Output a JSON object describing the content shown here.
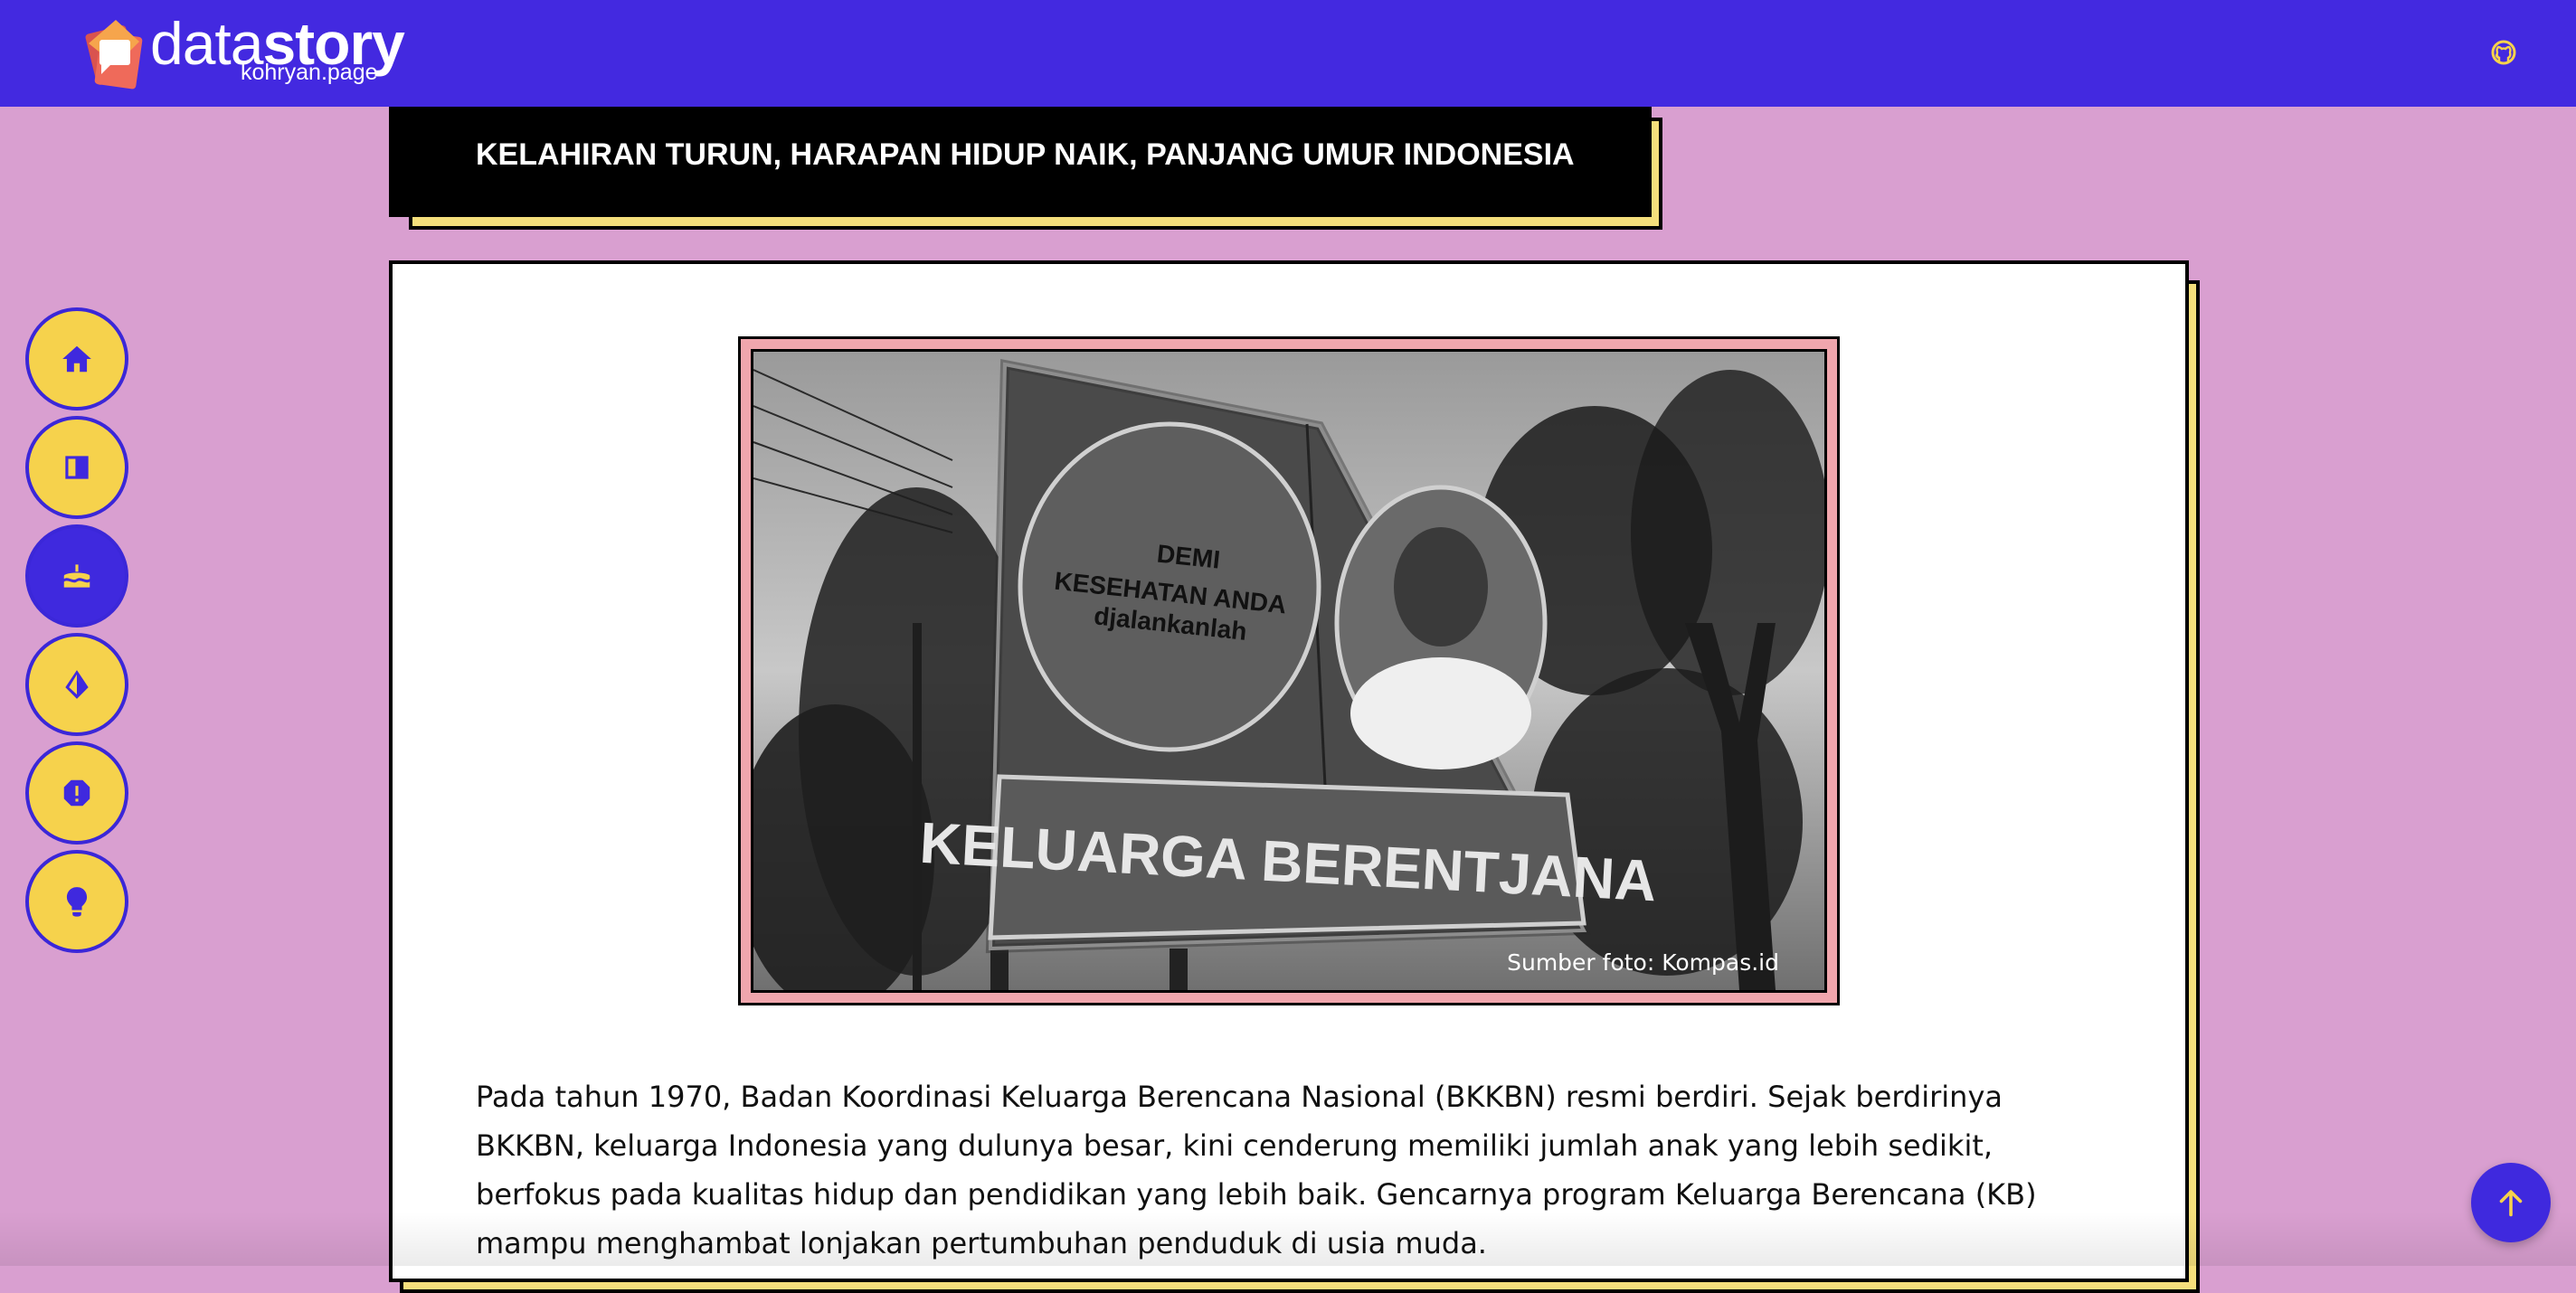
{
  "header": {
    "logo_text_light": "data",
    "logo_text_bold": "story",
    "logo_subtitle": "kohryan.page",
    "github_icon": "github-icon",
    "accent_color": "#4329e0"
  },
  "sidenav": {
    "items": [
      {
        "icon": "home-icon",
        "active": false
      },
      {
        "icon": "book-icon",
        "active": false
      },
      {
        "icon": "cake-icon",
        "active": true
      },
      {
        "icon": "sail-icon",
        "active": false
      },
      {
        "icon": "alert-icon",
        "active": false
      },
      {
        "icon": "lightbulb-icon",
        "active": false
      }
    ],
    "button_color": "#f6d24c"
  },
  "section": {
    "title": "KELAHIRAN TURUN, HARAPAN HIDUP NAIK, PANJANG UMUR INDONESIA"
  },
  "photo": {
    "billboard_line1": "DEMI",
    "billboard_line2": "KESEHATAN ANDA",
    "billboard_line3": "djalankanlah",
    "billboard_banner": "KELUARGA BERENTJANA",
    "caption": "Sumber foto: Kompas.id"
  },
  "paragraph": "Pada tahun 1970, Badan Koordinasi Keluarga Berencana Nasional (BKKBN) resmi berdiri. Sejak berdirinya BKKBN, keluarga Indonesia yang dulunya besar, kini cenderung memiliki jumlah anak yang lebih sedikit, berfokus pada kualitas hidup dan pendidikan yang lebih baik. Gencarnya program Keluarga Berencana (KB) mampu menghambat lonjakan pertumbuhan penduduk di usia muda.",
  "scroll_top_icon": "arrow-up-icon"
}
